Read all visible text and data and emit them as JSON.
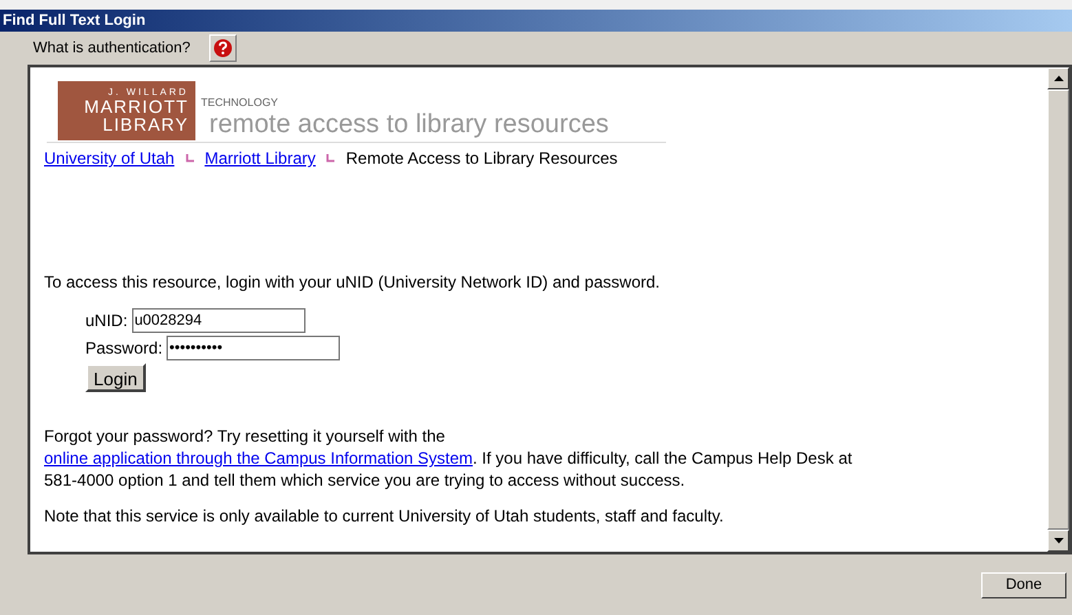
{
  "window": {
    "title": "Find Full Text Login"
  },
  "toolbar": {
    "help_label": "What is authentication?"
  },
  "header": {
    "logo_top": "J. WILLARD",
    "logo_middle": "MARRIOTT",
    "logo_bottom": "LIBRARY",
    "kicker": "TECHNOLOGY",
    "tagline": "remote access to library resources"
  },
  "breadcrumb": [
    {
      "label": "University of Utah",
      "kind": "link"
    },
    {
      "label": "Marriott Library",
      "kind": "link"
    },
    {
      "label": "Remote Access to Library Resources",
      "kind": "text"
    }
  ],
  "intro": "To access this resource, login with your uNID (University Network ID) and password.",
  "form": {
    "unid_label": "uNID:",
    "unid_value": "u0028294",
    "password_label": "Password:",
    "password_value": "••••••••••",
    "login_button": "Login"
  },
  "help": {
    "before": "Forgot your password? Try resetting it yourself with the ",
    "link": "online application through the Campus Information System",
    "after": ". If you have difficulty, call the Campus Help Desk at 581-4000 option 1 and tell them which service you are trying to access without success."
  },
  "note": "Note that this service is only available to current University of Utah students, staff and faculty.",
  "buttons": {
    "done": "Done"
  }
}
